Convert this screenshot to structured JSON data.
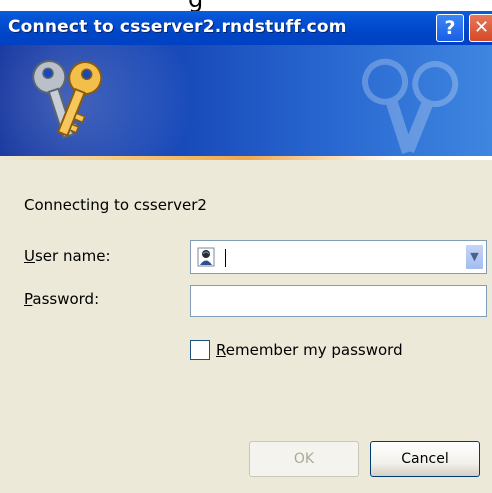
{
  "top_fragment": "g",
  "titlebar": {
    "title": "Connect to csserver2.rndstuff.com",
    "help_glyph": "?",
    "close_glyph": "✕"
  },
  "banner": {
    "icon": "keys-icon"
  },
  "form": {
    "connecting_text": "Connecting to csserver2",
    "user_label_mnemonic": "U",
    "user_label_rest": "ser name:",
    "user_value": "",
    "password_label_mnemonic": "P",
    "password_label_rest": "assword:",
    "password_value": "",
    "remember_mnemonic": "R",
    "remember_rest": "emember my password",
    "remember_checked": false
  },
  "buttons": {
    "ok": "OK",
    "cancel": "Cancel"
  },
  "colors": {
    "titlebar": "#0046c8",
    "dialog_bg": "#ece9d8",
    "banner": "#1748b8"
  }
}
